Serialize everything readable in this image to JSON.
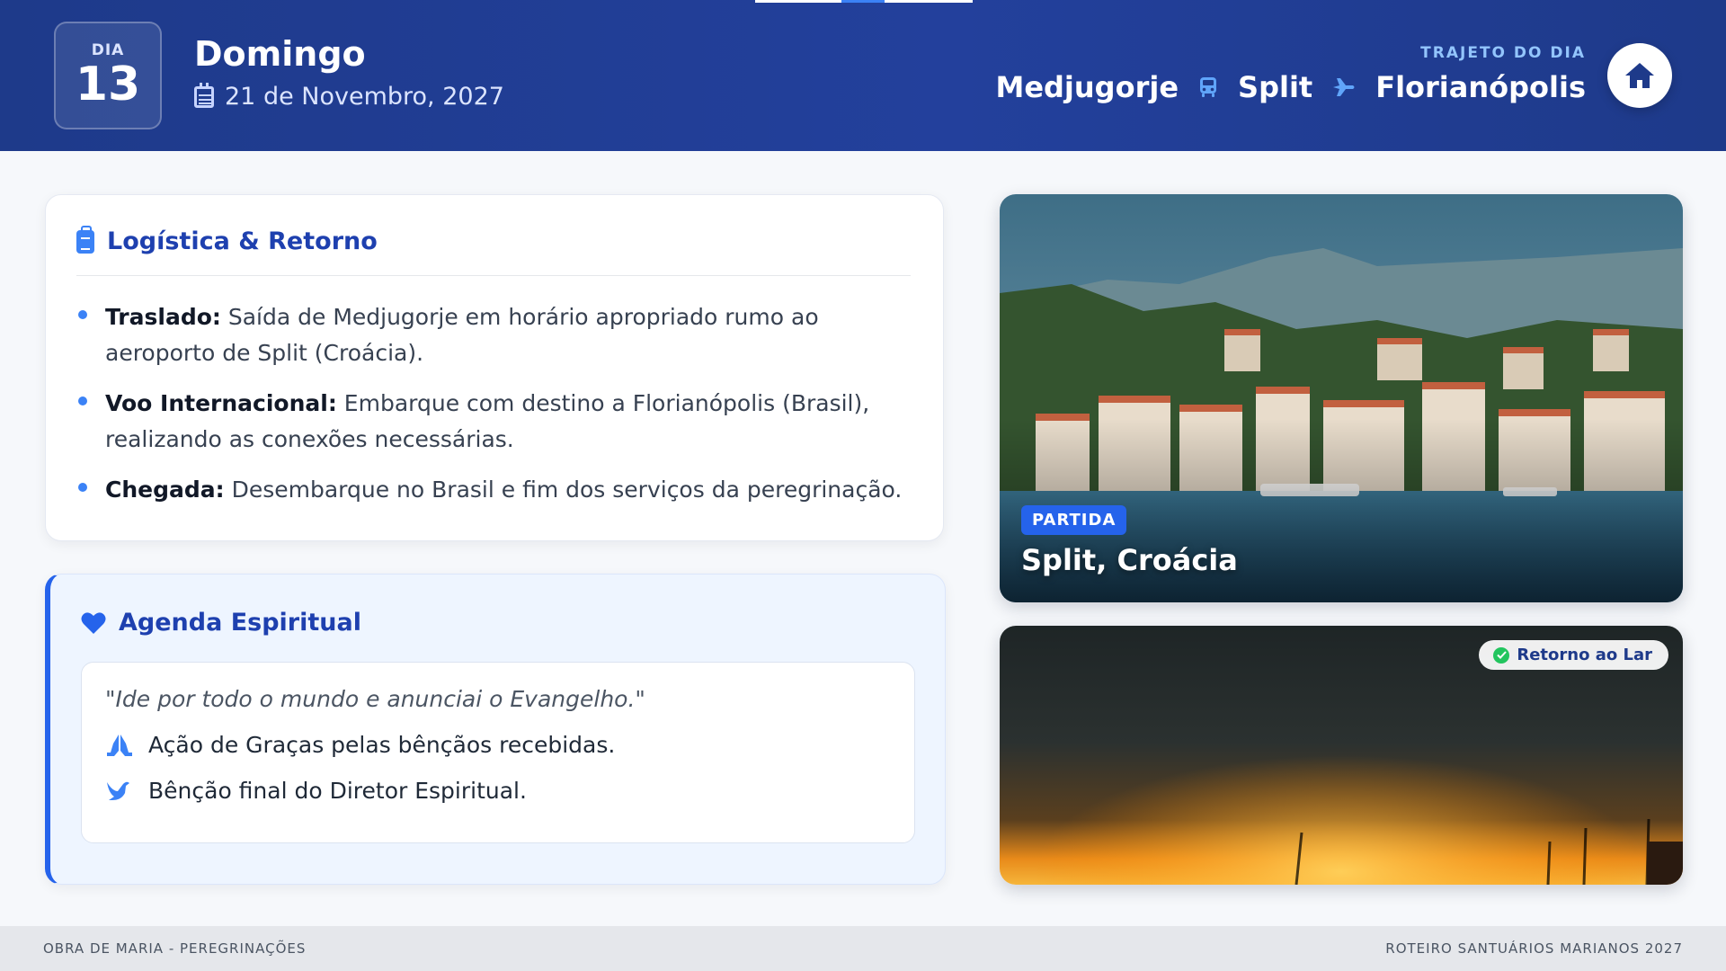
{
  "header": {
    "day_label": "DIA",
    "day_number": "13",
    "day_name": "Domingo",
    "date": "21 de Novembro, 2027",
    "route_label": "TRAJETO DO DIA",
    "route": {
      "from": "Medjugorje",
      "via": "Split",
      "to": "Florianópolis",
      "leg1_icon": "bus-icon",
      "leg2_icon": "plane-icon"
    },
    "home_icon": "home-icon"
  },
  "logistics": {
    "title": "Logística & Retorno",
    "icon": "luggage-icon",
    "items": [
      {
        "label": "Traslado:",
        "text": "Saída de Medjugorje em horário apropriado rumo ao aeroporto de Split (Croácia)."
      },
      {
        "label": "Voo Internacional:",
        "text": "Embarque com destino a Florianópolis (Brasil), realizando as conexões necessárias."
      },
      {
        "label": "Chegada:",
        "text": "Desembarque no Brasil e fim dos serviços da peregrinação."
      }
    ]
  },
  "agenda": {
    "title": "Agenda Espiritual",
    "icon": "heart-icon",
    "quote": "\"Ide por todo o mundo e anunciai o Evangelho.\"",
    "items": [
      {
        "icon": "praying-hands-icon",
        "text": "Ação de Graças pelas bênçãos recebidas."
      },
      {
        "icon": "dove-icon",
        "text": "Bênção final do Diretor Espiritual."
      }
    ]
  },
  "photos": {
    "split": {
      "badge": "PARTIDA",
      "title": "Split, Croácia"
    },
    "sunset": {
      "status": "Retorno ao Lar"
    }
  },
  "footer": {
    "left": "OBRA DE MARIA - PEREGRINAÇÕES",
    "right": "ROTEIRO SANTUÁRIOS MARIANOS 2027"
  },
  "colors": {
    "header_bg": "#1e3a8a",
    "accent": "#2563eb",
    "accent_light": "#3b82f6",
    "agenda_bg": "#eef5ff",
    "success": "#22c55e"
  }
}
